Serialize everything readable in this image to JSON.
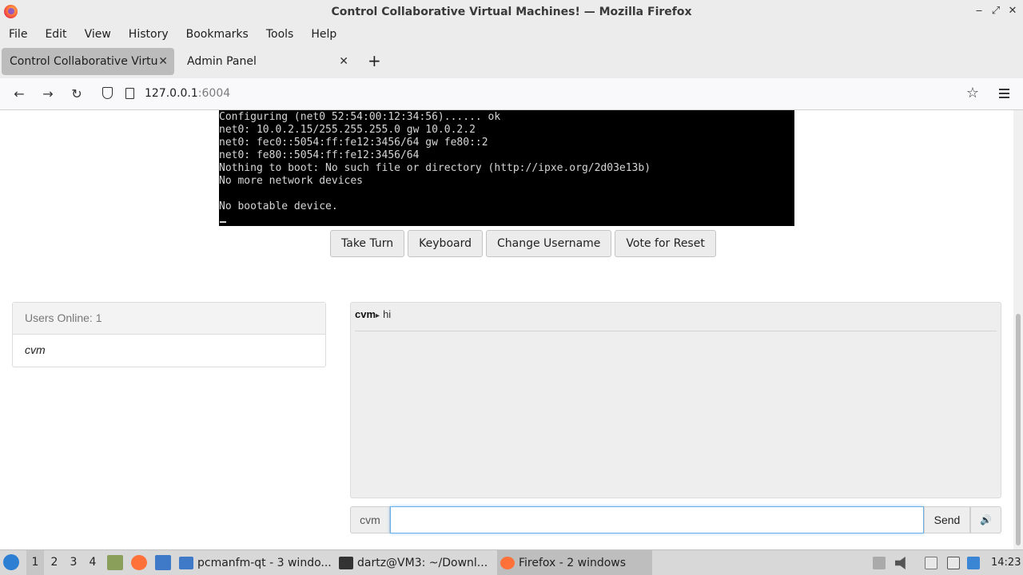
{
  "window": {
    "title": "Control Collaborative Virtual Machines! — Mozilla Firefox",
    "minimize": "‒",
    "maximize": "⤢",
    "close": "✕"
  },
  "menu": {
    "items": [
      "File",
      "Edit",
      "View",
      "History",
      "Bookmarks",
      "Tools",
      "Help"
    ]
  },
  "tabs": [
    {
      "label": "Control Collaborative Virtual Machines!",
      "close": "✕"
    },
    {
      "label": "Admin Panel",
      "close": "✕"
    }
  ],
  "new_tab": "+",
  "nav": {
    "back": "←",
    "forward": "→",
    "reload": "↻",
    "url_host": "127.0.0.1",
    "url_port": ":6004",
    "bookmark": "☆"
  },
  "console": {
    "lines": [
      "Configuring (net0 52:54:00:12:34:56)...... ok",
      "net0: 10.0.2.15/255.255.255.0 gw 10.0.2.2",
      "net0: fec0::5054:ff:fe12:3456/64 gw fe80::2",
      "net0: fe80::5054:ff:fe12:3456/64",
      "Nothing to boot: No such file or directory (http://ipxe.org/2d03e13b)",
      "No more network devices",
      "",
      "No bootable device."
    ]
  },
  "controls": {
    "take_turn": "Take Turn",
    "keyboard": "Keyboard",
    "change_username": "Change Username",
    "vote_reset": "Vote for Reset"
  },
  "users": {
    "header": "Users Online: 1",
    "list": [
      "cvm"
    ]
  },
  "chat": {
    "messages": [
      {
        "user": "cvm",
        "arrow": "▸",
        "text": "hi"
      }
    ],
    "input_prefix": "cvm",
    "input_value": "",
    "send_label": "Send",
    "volume_icon": "🔊"
  },
  "taskbar": {
    "workspaces": [
      "1",
      "2",
      "3",
      "4"
    ],
    "tasks": [
      {
        "label": "pcmanfm-qt - 3 windo..."
      },
      {
        "label": "dartz@VM3: ~/Downl..."
      },
      {
        "label": "Firefox - 2 windows"
      }
    ],
    "clock": "14:23"
  }
}
